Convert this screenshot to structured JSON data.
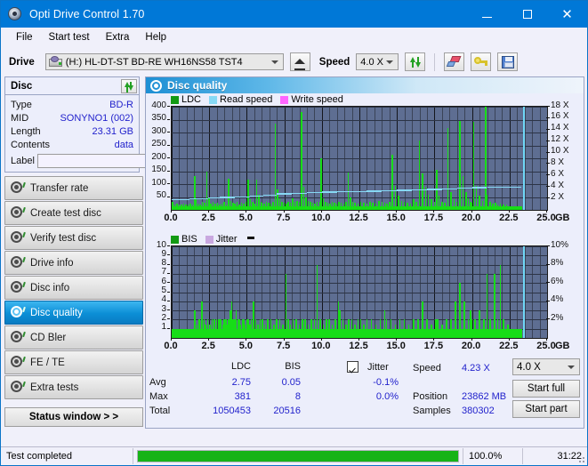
{
  "window": {
    "title": "Opti Drive Control 1.70",
    "icon": "disc-icon",
    "minimize": "minimize-icon",
    "maximize": "maximize-icon",
    "close": "close-icon"
  },
  "menu": {
    "items": [
      "File",
      "Start test",
      "Extra",
      "Help"
    ]
  },
  "toolbar": {
    "drive_label": "Drive",
    "drive_value": "(H:)  HL-DT-ST BD-RE  WH16NS58 TST4",
    "eject": "eject-icon",
    "speed_label": "Speed",
    "speed_value": "4.0 X",
    "refresh": "refresh-icon",
    "erase": "erase-icon",
    "key": "key-icon",
    "save": "save-icon"
  },
  "sidebar": {
    "disc_panel": {
      "title": "Disc",
      "refresh_icon": "refresh-icon",
      "rows": [
        {
          "key": "Type",
          "value": "BD-R"
        },
        {
          "key": "MID",
          "value": "SONYNO1 (002)"
        },
        {
          "key": "Length",
          "value": "23.31 GB"
        },
        {
          "key": "Contents",
          "value": "data"
        }
      ],
      "label_key": "Label",
      "label_value": "",
      "label_placeholder": "",
      "cd_button_icon": "cd-icon"
    },
    "nav": [
      {
        "label": "Transfer rate",
        "active": false
      },
      {
        "label": "Create test disc",
        "active": false
      },
      {
        "label": "Verify test disc",
        "active": false
      },
      {
        "label": "Drive info",
        "active": false
      },
      {
        "label": "Disc info",
        "active": false
      },
      {
        "label": "Disc quality",
        "active": true
      },
      {
        "label": "CD Bler",
        "active": false
      },
      {
        "label": "FE / TE",
        "active": false
      },
      {
        "label": "Extra tests",
        "active": false
      }
    ],
    "status_button": "Status window > >"
  },
  "panel": {
    "title": "Disc quality",
    "icon": "disc-quality-icon"
  },
  "stats": {
    "col_headers": [
      "LDC",
      "BIS"
    ],
    "rows": [
      {
        "label": "Avg",
        "ldc": "2.75",
        "bis": "0.05",
        "jitter": "-0.1%"
      },
      {
        "label": "Max",
        "ldc": "381",
        "bis": "8",
        "jitter": "0.0%"
      },
      {
        "label": "Total",
        "ldc": "1050453",
        "bis": "20516",
        "jitter": ""
      }
    ],
    "jitter_label": "Jitter",
    "jitter_checked": true,
    "speed_label": "Speed",
    "speed_value": "4.23 X",
    "position_label": "Position",
    "position_value": "23862 MB",
    "samples_label": "Samples",
    "samples_value": "380302",
    "speed_select": "4.0 X",
    "start_full": "Start full",
    "start_part": "Start part"
  },
  "statusbar": {
    "message": "Test completed",
    "percent_text": "100.0%",
    "percent_value": 100,
    "elapsed": "31:22"
  },
  "colors": {
    "accent": "#0078d7",
    "plot_bg": "#5e6e92",
    "ldc_green": "#17dd17",
    "read_speed": "#87d9f5",
    "write_speed": "#ff66ff",
    "jitter": "#c9a8e0",
    "value_blue": "#2222cc",
    "progress_green": "#17b317"
  },
  "chart_data": [
    {
      "type": "bar",
      "id": "ldc-chart",
      "title": "",
      "legend": [
        {
          "label": "LDC",
          "color": "#139a13"
        },
        {
          "label": "Read speed",
          "color": "#87d9f5"
        },
        {
          "label": "Write speed",
          "color": "#ff66ff"
        }
      ],
      "legend_position": "top-left",
      "xlabel": "GB",
      "xlim": [
        0,
        25
      ],
      "xticks": [
        "0.0",
        "2.5",
        "5.0",
        "7.5",
        "10.0",
        "12.5",
        "15.0",
        "17.5",
        "20.0",
        "22.5",
        "25.0"
      ],
      "ylabel": "",
      "ylim": [
        0,
        400
      ],
      "yticks": [
        50,
        100,
        150,
        200,
        250,
        300,
        350,
        400
      ],
      "y2label": "X",
      "y2lim": [
        0,
        18
      ],
      "y2ticks": [
        "2 X",
        "4 X",
        "6 X",
        "8 X",
        "10 X",
        "12 X",
        "14 X",
        "16 X",
        "18 X"
      ],
      "grid": true,
      "cursor_x": 23.4,
      "series": [
        {
          "name": "LDC",
          "color": "#17dd17",
          "x": [
            0.05,
            0.2,
            0.35,
            0.5,
            0.65,
            0.8,
            0.95,
            1.1,
            1.25,
            1.4,
            1.55,
            1.6,
            1.75,
            1.9,
            2.05,
            2.2,
            2.35,
            2.5,
            2.6,
            2.75,
            2.9,
            3.05,
            3.2,
            3.35,
            3.5,
            3.65,
            3.8,
            3.95,
            4.1,
            4.2,
            4.35,
            4.5,
            4.65,
            4.8,
            4.95,
            5.1,
            5.25,
            5.4,
            5.5,
            5.65,
            5.8,
            5.95,
            6.0,
            6.15,
            6.3,
            6.45,
            6.6,
            6.75,
            6.9,
            7.05,
            7.2,
            7.35,
            7.5,
            7.65,
            7.75,
            7.9,
            8.05,
            8.2,
            8.35,
            8.5,
            8.65,
            8.8,
            8.95,
            9.1,
            9.25,
            9.4,
            9.55,
            9.7,
            9.85,
            9.95,
            10.1,
            10.25,
            10.4,
            10.55,
            10.7,
            10.85,
            11.0,
            11.15,
            11.3,
            11.45,
            11.6,
            11.75,
            11.9,
            12.05,
            12.2,
            12.4,
            12.6,
            12.8,
            13.0,
            13.2,
            13.4,
            13.6,
            13.8,
            14.0,
            14.2,
            14.35,
            14.5,
            14.7,
            14.9,
            15.1,
            15.3,
            15.5,
            15.7,
            15.9,
            16.1,
            16.3,
            16.5,
            16.7,
            16.9,
            17.1,
            17.3,
            17.5,
            17.65,
            17.8,
            18.0,
            18.2,
            18.4,
            18.6,
            18.8,
            19.0,
            19.2,
            19.4,
            19.6,
            19.75,
            19.9,
            20.0,
            20.1,
            20.3,
            20.5,
            20.7,
            20.9,
            21.0,
            21.2,
            21.4,
            21.55,
            21.7,
            21.9,
            22.1,
            22.3,
            22.45,
            22.6,
            22.8,
            22.95,
            23.1,
            23.25
          ],
          "y": [
            30,
            22,
            25,
            20,
            22,
            24,
            20,
            22,
            25,
            20,
            130,
            40,
            25,
            22,
            30,
            28,
            150,
            45,
            25,
            30,
            25,
            28,
            22,
            25,
            30,
            22,
            120,
            35,
            28,
            25,
            30,
            22,
            28,
            25,
            30,
            118,
            40,
            30,
            25,
            118,
            60,
            30,
            28,
            25,
            30,
            28,
            25,
            30,
            335,
            80,
            45,
            30,
            28,
            25,
            30,
            28,
            45,
            30,
            35,
            30,
            378,
            90,
            50,
            35,
            30,
            28,
            25,
            30,
            32,
            200,
            45,
            30,
            28,
            25,
            30,
            28,
            25,
            30,
            28,
            25,
            30,
            145,
            50,
            30,
            28,
            25,
            30,
            28,
            25,
            30,
            28,
            25,
            35,
            30,
            28,
            25,
            30,
            215,
            95,
            55,
            35,
            30,
            28,
            25,
            40,
            30,
            270,
            140,
            90,
            60,
            40,
            30,
            155,
            55,
            30,
            28,
            318,
            70,
            40,
            30,
            345,
            130,
            70,
            45,
            30,
            28,
            343,
            95,
            55,
            35,
            400,
            60,
            30,
            25,
            28,
            22,
            25,
            20,
            22
          ]
        },
        {
          "name": "Read speed",
          "color": "#87d9f5",
          "x": [
            0.0,
            1.2,
            2.4,
            3.2,
            4.2,
            5.2,
            6.1,
            7.0,
            8.0,
            9.0,
            10.0,
            11.0,
            12.0,
            13.0,
            14.0,
            15.0,
            16.0,
            17.0,
            18.0,
            19.0,
            20.0,
            21.0,
            22.0,
            23.3
          ],
          "y_speed_x": [
            1.85,
            2.0,
            2.2,
            2.3,
            2.4,
            2.55,
            2.7,
            2.9,
            3.0,
            3.1,
            3.2,
            3.25,
            3.3,
            3.35,
            3.4,
            3.5,
            3.55,
            3.7,
            3.8,
            3.95,
            4.0,
            4.05,
            4.1,
            4.25
          ]
        }
      ]
    },
    {
      "type": "bar",
      "id": "bis-chart",
      "title": "",
      "legend": [
        {
          "label": "BIS",
          "color": "#139a13"
        },
        {
          "label": "Jitter",
          "color": "#c9a8e0"
        }
      ],
      "legend_position": "top-left",
      "xlabel": "GB",
      "xlim": [
        0,
        25
      ],
      "xticks": [
        "0.0",
        "2.5",
        "5.0",
        "7.5",
        "10.0",
        "12.5",
        "15.0",
        "17.5",
        "20.0",
        "22.5",
        "25.0"
      ],
      "ylim": [
        0,
        10
      ],
      "yticks": [
        1,
        2,
        3,
        4,
        5,
        6,
        7,
        8,
        9,
        10
      ],
      "y2label": "%",
      "y2lim": [
        0,
        10
      ],
      "y2ticks": [
        "2%",
        "4%",
        "6%",
        "8%",
        "10%"
      ],
      "grid": true,
      "cursor_x": 23.4,
      "series": [
        {
          "name": "BIS",
          "color": "#17dd17",
          "x": [
            0.05,
            0.2,
            0.35,
            0.5,
            0.65,
            0.8,
            0.95,
            1.1,
            1.25,
            1.4,
            1.55,
            1.7,
            1.85,
            2.0,
            2.15,
            2.25,
            2.4,
            2.55,
            2.7,
            2.85,
            3.0,
            3.1,
            3.2,
            3.3,
            3.4,
            3.5,
            3.6,
            3.7,
            3.8,
            3.9,
            4.0,
            4.1,
            4.2,
            4.3,
            4.4,
            4.5,
            4.6,
            4.7,
            4.8,
            4.9,
            5.0,
            5.1,
            5.2,
            5.3,
            5.45,
            5.6,
            5.75,
            5.9,
            6.05,
            6.2,
            6.4,
            6.6,
            6.8,
            7.0,
            7.2,
            7.4,
            7.6,
            7.75,
            7.9,
            8.1,
            8.3,
            8.5,
            8.7,
            8.9,
            9.1,
            9.3,
            9.5,
            9.7,
            9.9,
            10.1,
            10.3,
            10.5,
            10.7,
            10.9,
            11.1,
            11.2,
            11.4,
            11.6,
            11.8,
            12.0,
            12.2,
            12.4,
            12.6,
            12.8,
            13.0,
            13.3,
            13.6,
            13.9,
            14.2,
            14.3,
            14.6,
            14.9,
            15.2,
            15.5,
            15.8,
            16.1,
            16.4,
            16.7,
            17.0,
            17.3,
            17.6,
            17.7,
            18.0,
            18.3,
            18.6,
            18.9,
            19.2,
            19.5,
            19.75,
            19.9,
            20.0,
            20.2,
            20.5,
            20.8,
            21.0,
            21.2,
            21.5,
            21.7,
            21.9,
            22.1,
            22.4,
            22.7,
            22.9,
            23.1,
            23.25
          ],
          "y": [
            1,
            1,
            1,
            1,
            1,
            1,
            1,
            1,
            1,
            1,
            3,
            1.5,
            2,
            4,
            2,
            1.5,
            2,
            1.5,
            2,
            2,
            2,
            2,
            2,
            2,
            1.5,
            2,
            2,
            1.5,
            2,
            3,
            4,
            2,
            2,
            3,
            2,
            2,
            1.5,
            2,
            2,
            1.5,
            2,
            2,
            1.5,
            2,
            4,
            2,
            1.5,
            2,
            2,
            1.5,
            2,
            2,
            1.5,
            2,
            2,
            1.5,
            7,
            2,
            1.5,
            2,
            2,
            1.5,
            2,
            2,
            1.5,
            2,
            2,
            8,
            2,
            1.5,
            2,
            2,
            1.5,
            2,
            4,
            3,
            2,
            1.5,
            2,
            2,
            1.5,
            2,
            2,
            1.5,
            2,
            2,
            1.5,
            2,
            3,
            2,
            2,
            1.5,
            2,
            2,
            1.5,
            2,
            2,
            4,
            2,
            1.5,
            2,
            2,
            1.5,
            2,
            2,
            4,
            6,
            4,
            2,
            3,
            2,
            2,
            3,
            2,
            7,
            2,
            7,
            2,
            8,
            2,
            1.5
          ]
        }
      ]
    }
  ]
}
